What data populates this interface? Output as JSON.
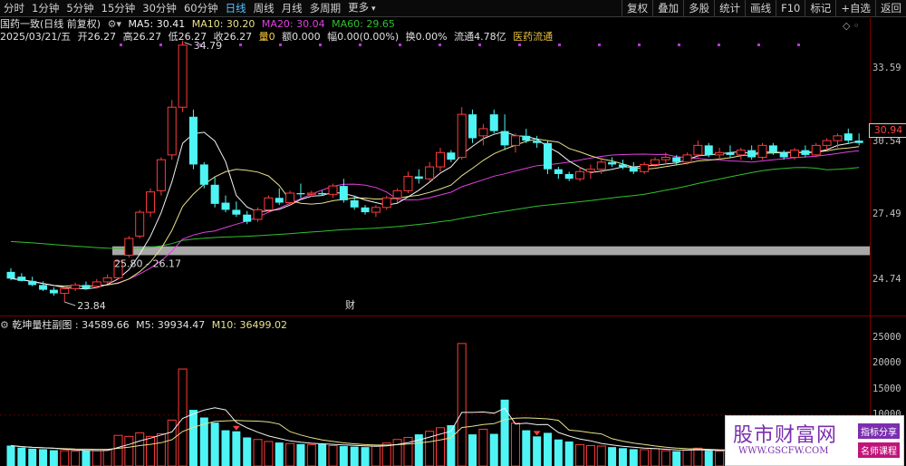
{
  "toolbar": {
    "period_tabs": [
      "分时",
      "1分钟",
      "5分钟",
      "15分钟",
      "30分钟",
      "60分钟",
      "日线",
      "周线",
      "月线",
      "多周期",
      "更多"
    ],
    "active_tab": "日线",
    "right_buttons": [
      "复权",
      "叠加",
      "多股",
      "统计",
      "画线",
      "F10",
      "标记",
      "+自选",
      "返回"
    ]
  },
  "header": {
    "stock_title": "国药一致(日线 前复权)",
    "ma5": "MA5: 30.41",
    "ma10": "MA10: 30.20",
    "ma20": "MA20: 30.04",
    "ma60": "MA60: 29.65"
  },
  "quote": {
    "date": "2025/03/21/五",
    "open": "开26.27",
    "high": "高26.27",
    "low": "低26.27",
    "close": "收26.27",
    "volume": "量0",
    "amount": "额0.000",
    "change": "幅0.00(0.00%)",
    "turnover": "换0.00%",
    "float": "流通4.78亿",
    "sector": "医药流通"
  },
  "chart_labels": {
    "high_marker": "34.79",
    "low_marker": "23.84",
    "gap_label": "25.80 - 26.17",
    "finance_marker": "财"
  },
  "price_axis": {
    "labels": [
      "33.59",
      "30.54",
      "27.49",
      "24.74"
    ],
    "last_price": "30.94"
  },
  "volume_header": {
    "name": "乾坤量柱副图",
    "value": ": 34589.66",
    "m5": "M5: 39934.47",
    "m10": "M10: 36499.02"
  },
  "volume_axis": {
    "labels": [
      "25000",
      "20000",
      "15000",
      "10000"
    ]
  },
  "watermark": {
    "title": "股市财富网",
    "url": "WWW.GSCFW.COM",
    "badge1": "指标分享",
    "badge2": "名师课程"
  },
  "colors": {
    "up": "#ff3b3b",
    "down": "#4ff4f4",
    "ma5": "#f2f2f2",
    "ma10": "#e8e08a",
    "ma20": "#e040e0",
    "ma60": "#30c030",
    "gap_band": "#a8a8a8",
    "axis_red": "#7a0000"
  },
  "chart_data": {
    "type": "candlestick",
    "price_axis_ticks": [
      33.59,
      30.54,
      27.49,
      24.74
    ],
    "ylim": [
      23.5,
      35.2
    ],
    "gap_band": [
      25.8,
      26.17
    ],
    "candles": [
      {
        "o": 25.1,
        "h": 25.25,
        "l": 24.75,
        "c": 24.82
      },
      {
        "o": 24.9,
        "h": 25.05,
        "l": 24.7,
        "c": 24.72
      },
      {
        "o": 24.72,
        "h": 24.9,
        "l": 24.5,
        "c": 24.55
      },
      {
        "o": 24.55,
        "h": 24.7,
        "l": 24.3,
        "c": 24.35
      },
      {
        "o": 24.35,
        "h": 24.45,
        "l": 24.1,
        "c": 24.2
      },
      {
        "o": 24.2,
        "h": 24.45,
        "l": 23.84,
        "c": 24.4
      },
      {
        "o": 24.4,
        "h": 24.65,
        "l": 24.3,
        "c": 24.55
      },
      {
        "o": 24.55,
        "h": 24.7,
        "l": 24.35,
        "c": 24.4
      },
      {
        "o": 24.5,
        "h": 24.8,
        "l": 24.4,
        "c": 24.68
      },
      {
        "o": 24.68,
        "h": 25.0,
        "l": 24.6,
        "c": 24.85
      },
      {
        "o": 24.85,
        "h": 25.6,
        "l": 24.8,
        "c": 25.55
      },
      {
        "o": 25.8,
        "h": 26.6,
        "l": 25.7,
        "c": 26.5
      },
      {
        "o": 26.6,
        "h": 27.7,
        "l": 26.5,
        "c": 27.6
      },
      {
        "o": 27.6,
        "h": 28.6,
        "l": 27.4,
        "c": 28.45
      },
      {
        "o": 28.5,
        "h": 29.9,
        "l": 28.3,
        "c": 29.8
      },
      {
        "o": 30.0,
        "h": 32.3,
        "l": 29.8,
        "c": 32.0
      },
      {
        "o": 32.0,
        "h": 34.79,
        "l": 31.8,
        "c": 34.6
      },
      {
        "o": 31.6,
        "h": 31.9,
        "l": 29.4,
        "c": 29.6
      },
      {
        "o": 29.6,
        "h": 29.7,
        "l": 28.6,
        "c": 28.75
      },
      {
        "o": 28.75,
        "h": 29.1,
        "l": 27.8,
        "c": 27.95
      },
      {
        "o": 28.0,
        "h": 28.3,
        "l": 27.6,
        "c": 27.7
      },
      {
        "o": 27.7,
        "h": 28.05,
        "l": 27.4,
        "c": 27.5
      },
      {
        "o": 27.5,
        "h": 27.65,
        "l": 27.1,
        "c": 27.2
      },
      {
        "o": 27.3,
        "h": 27.8,
        "l": 27.2,
        "c": 27.7
      },
      {
        "o": 27.7,
        "h": 28.3,
        "l": 27.6,
        "c": 28.2
      },
      {
        "o": 28.2,
        "h": 28.6,
        "l": 27.9,
        "c": 28.0
      },
      {
        "o": 28.0,
        "h": 28.5,
        "l": 27.9,
        "c": 28.4
      },
      {
        "o": 28.4,
        "h": 28.8,
        "l": 28.2,
        "c": 28.35
      },
      {
        "o": 28.35,
        "h": 28.5,
        "l": 28.25,
        "c": 28.4
      },
      {
        "o": 28.4,
        "h": 28.5,
        "l": 28.3,
        "c": 28.35
      },
      {
        "o": 28.35,
        "h": 28.8,
        "l": 28.2,
        "c": 28.7
      },
      {
        "o": 28.7,
        "h": 29.0,
        "l": 28.0,
        "c": 28.1
      },
      {
        "o": 28.1,
        "h": 28.3,
        "l": 27.7,
        "c": 27.8
      },
      {
        "o": 27.8,
        "h": 27.9,
        "l": 27.5,
        "c": 27.6
      },
      {
        "o": 27.6,
        "h": 27.9,
        "l": 27.4,
        "c": 27.8
      },
      {
        "o": 27.8,
        "h": 28.3,
        "l": 27.7,
        "c": 28.2
      },
      {
        "o": 28.2,
        "h": 28.6,
        "l": 28.0,
        "c": 28.5
      },
      {
        "o": 28.5,
        "h": 29.3,
        "l": 28.4,
        "c": 29.1
      },
      {
        "o": 29.1,
        "h": 29.4,
        "l": 28.8,
        "c": 29.0
      },
      {
        "o": 29.0,
        "h": 29.7,
        "l": 28.9,
        "c": 29.5
      },
      {
        "o": 29.5,
        "h": 30.3,
        "l": 29.3,
        "c": 30.1
      },
      {
        "o": 30.1,
        "h": 30.2,
        "l": 29.7,
        "c": 29.8
      },
      {
        "o": 29.9,
        "h": 32.0,
        "l": 29.8,
        "c": 31.7
      },
      {
        "o": 31.7,
        "h": 31.9,
        "l": 30.5,
        "c": 30.7
      },
      {
        "o": 30.8,
        "h": 31.3,
        "l": 30.4,
        "c": 31.1
      },
      {
        "o": 31.7,
        "h": 31.9,
        "l": 30.9,
        "c": 31.0
      },
      {
        "o": 31.0,
        "h": 31.7,
        "l": 30.2,
        "c": 30.4
      },
      {
        "o": 30.4,
        "h": 30.9,
        "l": 30.1,
        "c": 30.8
      },
      {
        "o": 30.8,
        "h": 31.1,
        "l": 30.5,
        "c": 30.6
      },
      {
        "o": 30.6,
        "h": 30.8,
        "l": 30.3,
        "c": 30.5
      },
      {
        "o": 30.5,
        "h": 30.6,
        "l": 29.2,
        "c": 29.4
      },
      {
        "o": 29.4,
        "h": 29.5,
        "l": 29.0,
        "c": 29.2
      },
      {
        "o": 29.2,
        "h": 29.3,
        "l": 28.9,
        "c": 29.0
      },
      {
        "o": 29.0,
        "h": 29.5,
        "l": 28.9,
        "c": 29.3
      },
      {
        "o": 29.3,
        "h": 29.6,
        "l": 29.0,
        "c": 29.4
      },
      {
        "o": 29.4,
        "h": 29.9,
        "l": 29.2,
        "c": 29.7
      },
      {
        "o": 29.7,
        "h": 29.9,
        "l": 29.5,
        "c": 29.6
      },
      {
        "o": 29.6,
        "h": 29.8,
        "l": 29.4,
        "c": 29.5
      },
      {
        "o": 29.5,
        "h": 29.7,
        "l": 29.2,
        "c": 29.3
      },
      {
        "o": 29.3,
        "h": 29.7,
        "l": 29.2,
        "c": 29.6
      },
      {
        "o": 29.6,
        "h": 29.9,
        "l": 29.5,
        "c": 29.8
      },
      {
        "o": 29.8,
        "h": 30.1,
        "l": 29.6,
        "c": 29.9
      },
      {
        "o": 29.9,
        "h": 30.0,
        "l": 29.6,
        "c": 29.7
      },
      {
        "o": 29.7,
        "h": 30.1,
        "l": 29.6,
        "c": 30.0
      },
      {
        "o": 30.0,
        "h": 30.6,
        "l": 29.9,
        "c": 30.4
      },
      {
        "o": 30.4,
        "h": 30.5,
        "l": 29.9,
        "c": 30.0
      },
      {
        "o": 30.0,
        "h": 30.3,
        "l": 29.8,
        "c": 30.1
      },
      {
        "o": 30.1,
        "h": 30.4,
        "l": 29.9,
        "c": 30.0
      },
      {
        "o": 30.0,
        "h": 30.3,
        "l": 29.8,
        "c": 30.2
      },
      {
        "o": 30.2,
        "h": 30.4,
        "l": 29.8,
        "c": 29.9
      },
      {
        "o": 29.9,
        "h": 30.5,
        "l": 29.8,
        "c": 30.4
      },
      {
        "o": 30.4,
        "h": 30.5,
        "l": 30.0,
        "c": 30.1
      },
      {
        "o": 30.1,
        "h": 30.2,
        "l": 29.8,
        "c": 29.9
      },
      {
        "o": 29.9,
        "h": 30.3,
        "l": 29.8,
        "c": 30.2
      },
      {
        "o": 30.2,
        "h": 30.4,
        "l": 29.9,
        "c": 30.0
      },
      {
        "o": 30.0,
        "h": 30.5,
        "l": 29.9,
        "c": 30.4
      },
      {
        "o": 30.4,
        "h": 30.7,
        "l": 30.2,
        "c": 30.6
      },
      {
        "o": 30.6,
        "h": 30.9,
        "l": 30.3,
        "c": 30.8
      },
      {
        "o": 30.9,
        "h": 31.1,
        "l": 30.5,
        "c": 30.6
      },
      {
        "o": 30.6,
        "h": 30.9,
        "l": 30.4,
        "c": 30.5
      }
    ],
    "volume": {
      "name": "乾坤量柱副图",
      "ylim": [
        0,
        27000
      ],
      "ticks": [
        25000,
        20000,
        15000,
        10000
      ],
      "values": [
        4000,
        3600,
        3400,
        3300,
        3100,
        3000,
        2900,
        3100,
        3000,
        3200,
        6000,
        5800,
        6500,
        5800,
        6300,
        9000,
        19000,
        11000,
        9500,
        8500,
        7000,
        6800,
        5600,
        5200,
        4800,
        4600,
        4400,
        4300,
        4200,
        4300,
        4000,
        3900,
        3800,
        3700,
        3900,
        4500,
        5200,
        5600,
        6200,
        6800,
        7500,
        8000,
        24000,
        6200,
        7200,
        6300,
        13000,
        8400,
        7000,
        5800,
        6500,
        5200,
        4800,
        4200,
        4000,
        3900,
        3700,
        3500,
        3300,
        3200,
        3400,
        3000,
        2900,
        3100,
        3500,
        3000,
        2900,
        2800,
        3000,
        2700,
        3300,
        2900,
        2600,
        3000,
        2600,
        3800,
        3000,
        2700,
        3400,
        2800
      ],
      "up_flags": [
        0,
        0,
        0,
        0,
        0,
        1,
        1,
        0,
        1,
        1,
        1,
        1,
        1,
        1,
        1,
        1,
        1,
        0,
        0,
        0,
        0,
        0,
        0,
        1,
        1,
        0,
        1,
        0,
        1,
        0,
        1,
        0,
        0,
        0,
        1,
        1,
        1,
        1,
        0,
        1,
        1,
        0,
        1,
        0,
        1,
        0,
        0,
        1,
        0,
        0,
        0,
        0,
        0,
        1,
        1,
        1,
        0,
        0,
        0,
        1,
        1,
        1,
        0,
        1,
        1,
        0,
        1,
        0,
        1,
        0,
        1,
        0,
        0,
        1,
        0,
        1,
        1,
        1,
        0,
        0
      ]
    }
  }
}
